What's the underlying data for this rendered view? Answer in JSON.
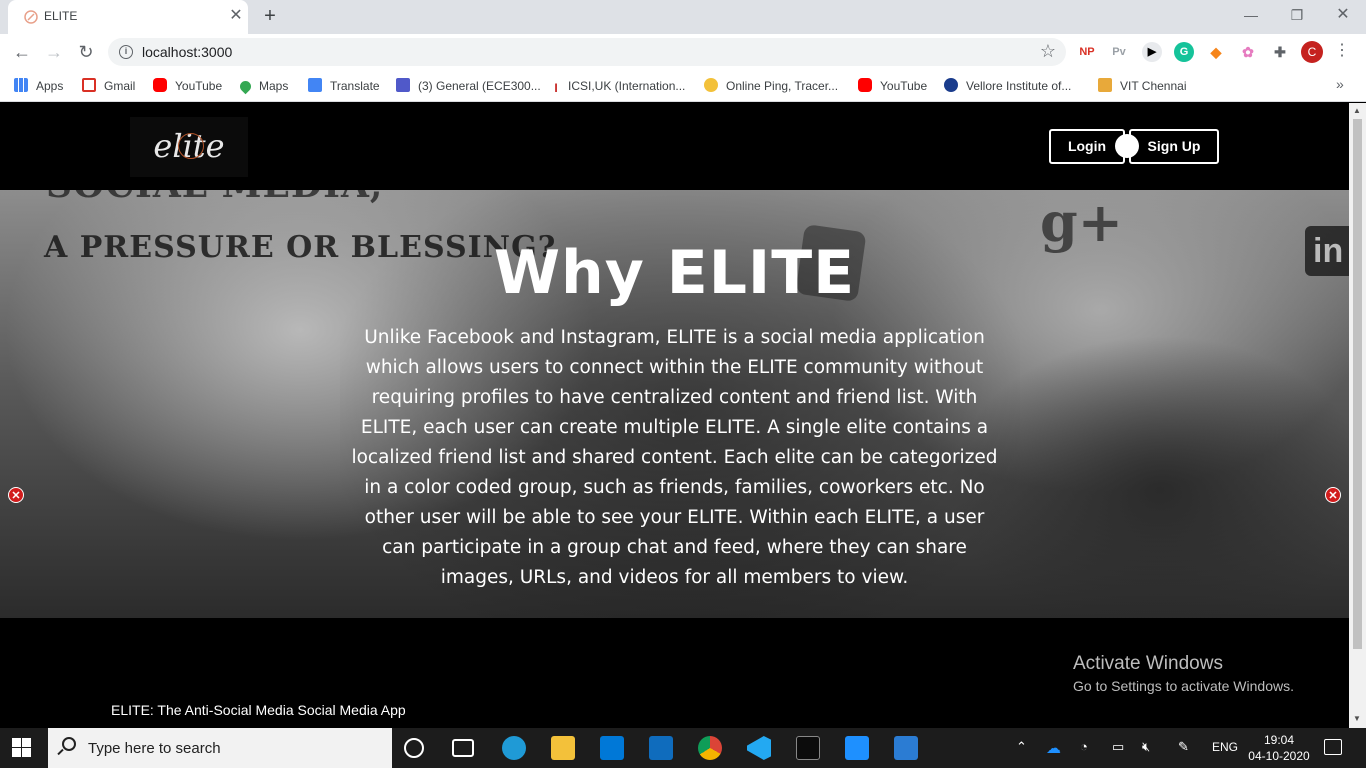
{
  "browser": {
    "tab_title": "ELITE",
    "url": "localhost:3000",
    "profile_initial": "C",
    "extensions": [
      "NP",
      "Pv"
    ],
    "bookmarks": [
      {
        "label": "Apps",
        "icon": "apps-grid-icon"
      },
      {
        "label": "Gmail",
        "icon": "gmail-icon"
      },
      {
        "label": "YouTube",
        "icon": "youtube-icon"
      },
      {
        "label": "Maps",
        "icon": "maps-icon"
      },
      {
        "label": "Translate",
        "icon": "translate-icon"
      },
      {
        "label": "(3) General (ECE300...",
        "icon": "teams-icon"
      },
      {
        "label": "ICSI,UK (Internation...",
        "icon": "icsi-icon"
      },
      {
        "label": "Online Ping, Tracer...",
        "icon": "ping-icon"
      },
      {
        "label": "YouTube",
        "icon": "youtube-icon"
      },
      {
        "label": "Vellore Institute of...",
        "icon": "vit-icon"
      },
      {
        "label": "VIT Chennai",
        "icon": "vit-chennai-icon"
      }
    ]
  },
  "site": {
    "logo_text": "elite",
    "login_label": "Login",
    "signup_label": "Sign Up",
    "hero_bg_line1": "SOCIAL MEDIA,",
    "hero_bg_line2": "A PRESSURE OR BLESSING?",
    "hero_title": "Why ELITE",
    "hero_body": "Unlike Facebook and Instagram, ELITE is a social media application which allows users to connect within the ELITE community without requiring profiles to have centralized content and friend list. With ELITE, each user can create multiple ELITE. A single elite contains a localized friend list and shared content. Each elite can be categorized in a color coded group, such as friends, families, coworkers etc. No other user will be able to see your ELITE. Within each ELITE, a user can participate in a group chat and feed, where they can share images, URLs, and videos for all members to view.",
    "footer_text": "ELITE: The Anti-Social Media Social Media App"
  },
  "watermark": {
    "title": "Activate Windows",
    "subtitle": "Go to Settings to activate Windows."
  },
  "taskbar": {
    "search_placeholder": "Type here to search",
    "language": "ENG",
    "time": "19:04",
    "date": "04-10-2020"
  },
  "colors": {
    "accent_red": "#d11c1c",
    "page_bg": "#000000"
  }
}
